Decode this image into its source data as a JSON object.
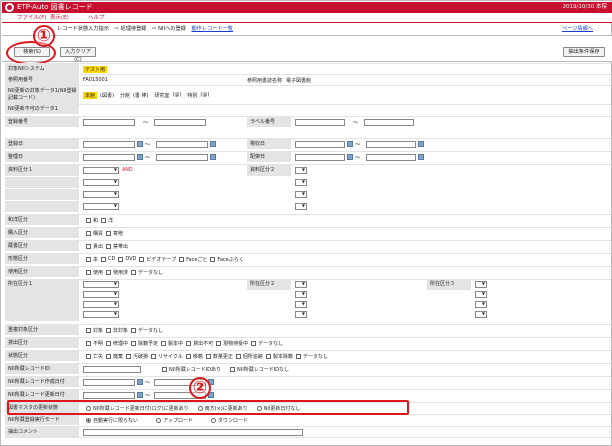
{
  "window": {
    "title": "ETP-Auto 図書レコード",
    "date": "2019/10/30 本院"
  },
  "menu": [
    {
      "label": "ファイル(F)"
    },
    {
      "label": "表示(E)"
    },
    {
      "label": "ヘルプ"
    }
  ],
  "breadcrumb": {
    "items": [
      "レコード状態入力指示",
      "⇨ 処理待登録",
      "⇨ NIIへの登録"
    ],
    "link": "動作レコード一覧",
    "page_link": "ページ情報へ"
  },
  "toolbar": {
    "search_label": "検索(S)",
    "clear_label": "入力クリア(C)",
    "save_label": "抽出条件保存"
  },
  "callouts": {
    "one": "①",
    "two": "②"
  },
  "fields": {
    "system": {
      "label": "対象NIIシステム",
      "value": "テスト用"
    },
    "ref_no": {
      "label": "参照用番号",
      "value": "FA015001",
      "right_label": "参照用書誌名称",
      "right_value": "電子図書館"
    },
    "nii_reg": {
      "label": "NII更新の対象データ1(NII登録記載コード)",
      "options": [
        "本館",
        "(図書)",
        "分館",
        "(書 棒)",
        "研究室",
        "(@)",
        "特別",
        "(@)"
      ]
    },
    "nii_reg_label2": {
      "label": "NII更新不可のデータ1"
    },
    "reg_no": {
      "label": "登録番号",
      "tilde": "～",
      "right_label": "ラベル番号"
    },
    "reg_date": {
      "label": "登録日",
      "tilde": "～",
      "right_label": "検収日"
    },
    "order_no": {
      "label": "整理日",
      "tilde": "～",
      "right_label": "配架日"
    },
    "mat1": {
      "label": "資料区分１",
      "and": "AND",
      "right_label": "資料区分２"
    },
    "or": "OR",
    "and": "AND",
    "hold": {
      "label": "和洋区分",
      "options": [
        "和",
        "洋"
      ]
    },
    "acq": {
      "label": "購入区分",
      "options": [
        "購買",
        "寄贈"
      ]
    },
    "dist": {
      "label": "蔵書区分",
      "options": [
        "貴出",
        "禁帯出"
      ]
    },
    "media": {
      "label": "形態区分",
      "options": [
        "本",
        "CD",
        "DVD",
        "ビデオテープ",
        "Faceごと",
        "Faceぶらく"
      ]
    },
    "useflag": {
      "label": "使用区分",
      "options": [
        "使用",
        "使用済",
        "データなし"
      ]
    },
    "loc1": {
      "label": "所在区分１",
      "mid_label": "所在区分２",
      "right_label": "所在区分３"
    },
    "dup": {
      "label": "重複対象区分",
      "options": [
        "対象",
        "非対象",
        "データなし"
      ]
    },
    "status": {
      "label": "貸出区分",
      "options": [
        "不明",
        "修理中",
        "除籍予定",
        "製本中",
        "貸出不可",
        "現物待受中",
        "データなし"
      ]
    },
    "discard": {
      "label": "状態区分",
      "options": [
        "亡失",
        "廃棄",
        "汚破損",
        "リサイクル",
        "移籍",
        "数量更正",
        "個所追跡",
        "製本除籍",
        "データなし"
      ]
    },
    "nii_rec": {
      "label": "NII所蔵レコードID",
      "options": [
        "NII所蔵レコードIDあり",
        "NII所蔵レコードIDなし"
      ]
    },
    "nii_date": {
      "label": "NII所蔵レコード作成日付",
      "tilde": "～"
    },
    "nii_upd": {
      "label": "NII所蔵レコード更新日付",
      "tilde": "～"
    },
    "master": {
      "label": "図書マスタの更新状態",
      "options": [
        "NII所蔵レコード更新日付(ログ)に更新あり",
        "両方(×)に更新あり",
        "NII更新日付なし"
      ]
    },
    "mode": {
      "label": "NII所蔵登録実行モード",
      "options": [
        "自動実行に限らない",
        "アップロード",
        "ダウンロード"
      ]
    },
    "comment": {
      "label": "抽出コメント"
    }
  }
}
